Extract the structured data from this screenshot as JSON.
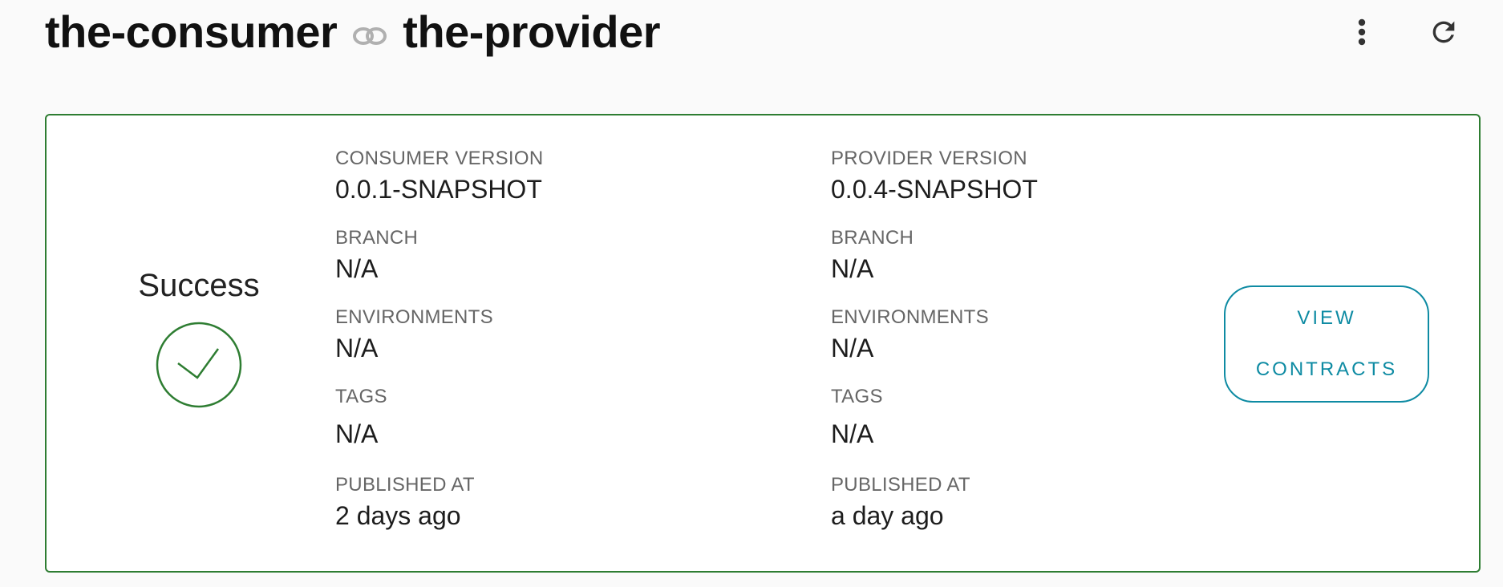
{
  "header": {
    "consumer_name": "the-consumer",
    "provider_name": "the-provider",
    "link_icon": "link-icon",
    "more_icon": "more-vertical-icon",
    "refresh_icon": "refresh-icon"
  },
  "card": {
    "status": "Success",
    "status_icon": "check-circle-icon",
    "border_color": "#2e7d32",
    "consumer": {
      "version_label": "CONSUMER VERSION",
      "version": "0.0.1-SNAPSHOT",
      "branch_label": "BRANCH",
      "branch": "N/A",
      "environments_label": "ENVIRONMENTS",
      "environments": "N/A",
      "tags_label": "TAGS",
      "tags": "N/A",
      "published_label": "PUBLISHED AT",
      "published": "2 days ago"
    },
    "provider": {
      "version_label": "PROVIDER VERSION",
      "version": "0.0.4-SNAPSHOT",
      "branch_label": "BRANCH",
      "branch": "N/A",
      "environments_label": "ENVIRONMENTS",
      "environments": "N/A",
      "tags_label": "TAGS",
      "tags": "N/A",
      "published_label": "PUBLISHED AT",
      "published": "a day ago"
    },
    "view_button": {
      "line1": "VIEW",
      "line2": "CONTRACTS",
      "color": "#0e8ba3"
    }
  }
}
